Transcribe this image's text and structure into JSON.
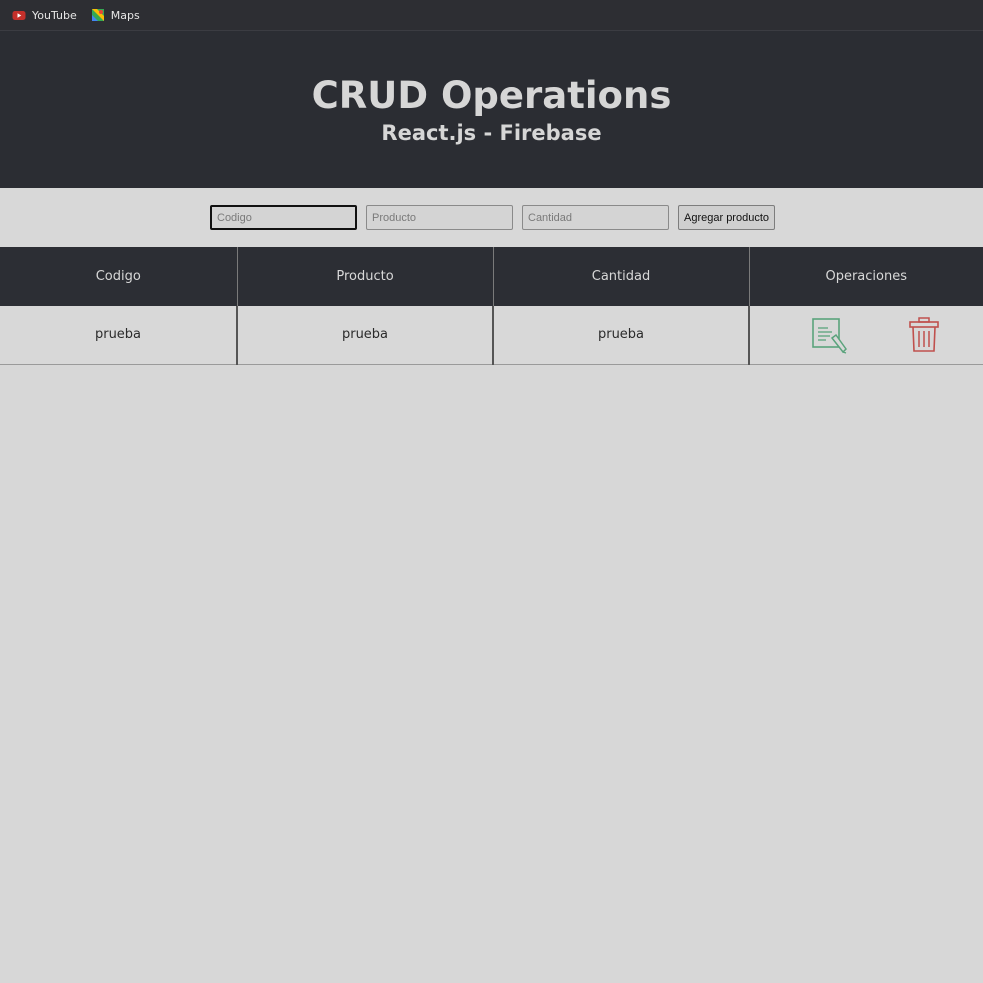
{
  "bookmarks": [
    {
      "label": "YouTube",
      "icon": "youtube-icon"
    },
    {
      "label": "Maps",
      "icon": "maps-icon"
    }
  ],
  "header": {
    "title": "CRUD Operations",
    "subtitle": "React.js - Firebase"
  },
  "form": {
    "codigo_placeholder": "Codigo",
    "producto_placeholder": "Producto",
    "cantidad_placeholder": "Cantidad",
    "codigo_value": "",
    "producto_value": "",
    "cantidad_value": "",
    "submit_label": "Agregar producto"
  },
  "table": {
    "headers": [
      "Codigo",
      "Producto",
      "Cantidad",
      "Operaciones"
    ],
    "rows": [
      {
        "codigo": "prueba",
        "producto": "prueba",
        "cantidad": "prueba",
        "actions": [
          "edit-icon",
          "trash-icon"
        ]
      }
    ]
  },
  "colors": {
    "header_bg": "#2b2d33",
    "page_bg": "#d8d8d8",
    "edit_icon": "#5aa37c",
    "delete_icon": "#c0504d"
  }
}
